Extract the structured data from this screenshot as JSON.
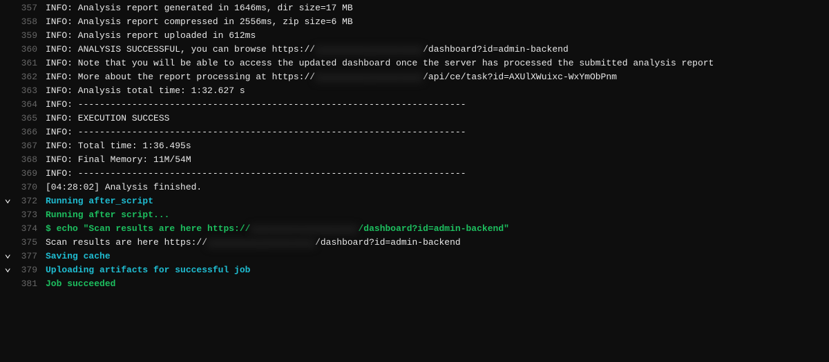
{
  "lines": [
    {
      "num": "357",
      "chevron": false,
      "segments": [
        {
          "cls": "white-text",
          "text": "INFO: Analysis report generated in 1646ms, dir size=17 MB"
        }
      ]
    },
    {
      "num": "358",
      "chevron": false,
      "segments": [
        {
          "cls": "white-text",
          "text": "INFO: Analysis report compressed in 2556ms, zip size=6 MB"
        }
      ]
    },
    {
      "num": "359",
      "chevron": false,
      "segments": [
        {
          "cls": "white-text",
          "text": "INFO: Analysis report uploaded in 612ms"
        }
      ]
    },
    {
      "num": "360",
      "chevron": false,
      "segments": [
        {
          "cls": "white-text",
          "text": "INFO: ANALYSIS SUCCESSFUL, you can browse https://"
        },
        {
          "cls": "redacted",
          "text": "sonar.example.com.io"
        },
        {
          "cls": "white-text",
          "text": "/dashboard?id=admin-backend"
        }
      ]
    },
    {
      "num": "361",
      "chevron": false,
      "segments": [
        {
          "cls": "white-text",
          "text": "INFO: Note that you will be able to access the updated dashboard once the server has processed the submitted analysis report"
        }
      ]
    },
    {
      "num": "362",
      "chevron": false,
      "segments": [
        {
          "cls": "white-text",
          "text": "INFO: More about the report processing at https://"
        },
        {
          "cls": "redacted",
          "text": "sonar.example.com.io"
        },
        {
          "cls": "white-text",
          "text": "/api/ce/task?id=AXUlXWuixc-WxYmObPnm"
        }
      ]
    },
    {
      "num": "363",
      "chevron": false,
      "segments": [
        {
          "cls": "white-text",
          "text": "INFO: Analysis total time: 1:32.627 s"
        }
      ]
    },
    {
      "num": "364",
      "chevron": false,
      "segments": [
        {
          "cls": "white-text",
          "text": "INFO: ------------------------------------------------------------------------"
        }
      ]
    },
    {
      "num": "365",
      "chevron": false,
      "segments": [
        {
          "cls": "white-text",
          "text": "INFO: EXECUTION SUCCESS"
        }
      ]
    },
    {
      "num": "366",
      "chevron": false,
      "segments": [
        {
          "cls": "white-text",
          "text": "INFO: ------------------------------------------------------------------------"
        }
      ]
    },
    {
      "num": "367",
      "chevron": false,
      "segments": [
        {
          "cls": "white-text",
          "text": "INFO: Total time: 1:36.495s"
        }
      ]
    },
    {
      "num": "368",
      "chevron": false,
      "segments": [
        {
          "cls": "white-text",
          "text": "INFO: Final Memory: 11M/54M"
        }
      ]
    },
    {
      "num": "369",
      "chevron": false,
      "segments": [
        {
          "cls": "white-text",
          "text": "INFO: ------------------------------------------------------------------------"
        }
      ]
    },
    {
      "num": "370",
      "chevron": false,
      "segments": [
        {
          "cls": "white-text",
          "text": "[04:28:02] Analysis finished."
        }
      ]
    },
    {
      "num": "372",
      "chevron": true,
      "segments": [
        {
          "cls": "section-header",
          "text": "Running after_script"
        }
      ]
    },
    {
      "num": "373",
      "chevron": false,
      "segments": [
        {
          "cls": "green-text",
          "text": "Running after script..."
        }
      ]
    },
    {
      "num": "374",
      "chevron": false,
      "segments": [
        {
          "cls": "green-text",
          "text": "$ echo \"Scan results are here https://"
        },
        {
          "cls": "redacted",
          "text": "sonar.example.com.io"
        },
        {
          "cls": "green-text",
          "text": "/dashboard?id=admin-backend\""
        }
      ]
    },
    {
      "num": "375",
      "chevron": false,
      "segments": [
        {
          "cls": "white-text",
          "text": "Scan results are here https://"
        },
        {
          "cls": "redacted",
          "text": "sonar.example.com.io"
        },
        {
          "cls": "white-text",
          "text": "/dashboard?id=admin-backend"
        }
      ]
    },
    {
      "num": "377",
      "chevron": true,
      "segments": [
        {
          "cls": "section-header",
          "text": "Saving cache"
        }
      ]
    },
    {
      "num": "379",
      "chevron": true,
      "segments": [
        {
          "cls": "section-header",
          "text": "Uploading artifacts for successful job"
        }
      ]
    },
    {
      "num": "381",
      "chevron": false,
      "segments": [
        {
          "cls": "green-text",
          "text": "Job succeeded"
        }
      ]
    }
  ]
}
